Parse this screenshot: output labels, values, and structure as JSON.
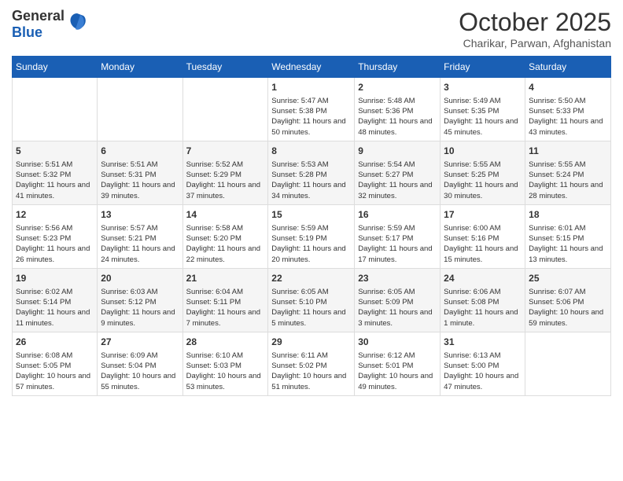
{
  "header": {
    "logo_general": "General",
    "logo_blue": "Blue",
    "month": "October 2025",
    "location": "Charikar, Parwan, Afghanistan"
  },
  "weekdays": [
    "Sunday",
    "Monday",
    "Tuesday",
    "Wednesday",
    "Thursday",
    "Friday",
    "Saturday"
  ],
  "weeks": [
    [
      {
        "day": "",
        "info": ""
      },
      {
        "day": "",
        "info": ""
      },
      {
        "day": "",
        "info": ""
      },
      {
        "day": "1",
        "info": "Sunrise: 5:47 AM\nSunset: 5:38 PM\nDaylight: 11 hours and 50 minutes."
      },
      {
        "day": "2",
        "info": "Sunrise: 5:48 AM\nSunset: 5:36 PM\nDaylight: 11 hours and 48 minutes."
      },
      {
        "day": "3",
        "info": "Sunrise: 5:49 AM\nSunset: 5:35 PM\nDaylight: 11 hours and 45 minutes."
      },
      {
        "day": "4",
        "info": "Sunrise: 5:50 AM\nSunset: 5:33 PM\nDaylight: 11 hours and 43 minutes."
      }
    ],
    [
      {
        "day": "5",
        "info": "Sunrise: 5:51 AM\nSunset: 5:32 PM\nDaylight: 11 hours and 41 minutes."
      },
      {
        "day": "6",
        "info": "Sunrise: 5:51 AM\nSunset: 5:31 PM\nDaylight: 11 hours and 39 minutes."
      },
      {
        "day": "7",
        "info": "Sunrise: 5:52 AM\nSunset: 5:29 PM\nDaylight: 11 hours and 37 minutes."
      },
      {
        "day": "8",
        "info": "Sunrise: 5:53 AM\nSunset: 5:28 PM\nDaylight: 11 hours and 34 minutes."
      },
      {
        "day": "9",
        "info": "Sunrise: 5:54 AM\nSunset: 5:27 PM\nDaylight: 11 hours and 32 minutes."
      },
      {
        "day": "10",
        "info": "Sunrise: 5:55 AM\nSunset: 5:25 PM\nDaylight: 11 hours and 30 minutes."
      },
      {
        "day": "11",
        "info": "Sunrise: 5:55 AM\nSunset: 5:24 PM\nDaylight: 11 hours and 28 minutes."
      }
    ],
    [
      {
        "day": "12",
        "info": "Sunrise: 5:56 AM\nSunset: 5:23 PM\nDaylight: 11 hours and 26 minutes."
      },
      {
        "day": "13",
        "info": "Sunrise: 5:57 AM\nSunset: 5:21 PM\nDaylight: 11 hours and 24 minutes."
      },
      {
        "day": "14",
        "info": "Sunrise: 5:58 AM\nSunset: 5:20 PM\nDaylight: 11 hours and 22 minutes."
      },
      {
        "day": "15",
        "info": "Sunrise: 5:59 AM\nSunset: 5:19 PM\nDaylight: 11 hours and 20 minutes."
      },
      {
        "day": "16",
        "info": "Sunrise: 5:59 AM\nSunset: 5:17 PM\nDaylight: 11 hours and 17 minutes."
      },
      {
        "day": "17",
        "info": "Sunrise: 6:00 AM\nSunset: 5:16 PM\nDaylight: 11 hours and 15 minutes."
      },
      {
        "day": "18",
        "info": "Sunrise: 6:01 AM\nSunset: 5:15 PM\nDaylight: 11 hours and 13 minutes."
      }
    ],
    [
      {
        "day": "19",
        "info": "Sunrise: 6:02 AM\nSunset: 5:14 PM\nDaylight: 11 hours and 11 minutes."
      },
      {
        "day": "20",
        "info": "Sunrise: 6:03 AM\nSunset: 5:12 PM\nDaylight: 11 hours and 9 minutes."
      },
      {
        "day": "21",
        "info": "Sunrise: 6:04 AM\nSunset: 5:11 PM\nDaylight: 11 hours and 7 minutes."
      },
      {
        "day": "22",
        "info": "Sunrise: 6:05 AM\nSunset: 5:10 PM\nDaylight: 11 hours and 5 minutes."
      },
      {
        "day": "23",
        "info": "Sunrise: 6:05 AM\nSunset: 5:09 PM\nDaylight: 11 hours and 3 minutes."
      },
      {
        "day": "24",
        "info": "Sunrise: 6:06 AM\nSunset: 5:08 PM\nDaylight: 11 hours and 1 minute."
      },
      {
        "day": "25",
        "info": "Sunrise: 6:07 AM\nSunset: 5:06 PM\nDaylight: 10 hours and 59 minutes."
      }
    ],
    [
      {
        "day": "26",
        "info": "Sunrise: 6:08 AM\nSunset: 5:05 PM\nDaylight: 10 hours and 57 minutes."
      },
      {
        "day": "27",
        "info": "Sunrise: 6:09 AM\nSunset: 5:04 PM\nDaylight: 10 hours and 55 minutes."
      },
      {
        "day": "28",
        "info": "Sunrise: 6:10 AM\nSunset: 5:03 PM\nDaylight: 10 hours and 53 minutes."
      },
      {
        "day": "29",
        "info": "Sunrise: 6:11 AM\nSunset: 5:02 PM\nDaylight: 10 hours and 51 minutes."
      },
      {
        "day": "30",
        "info": "Sunrise: 6:12 AM\nSunset: 5:01 PM\nDaylight: 10 hours and 49 minutes."
      },
      {
        "day": "31",
        "info": "Sunrise: 6:13 AM\nSunset: 5:00 PM\nDaylight: 10 hours and 47 minutes."
      },
      {
        "day": "",
        "info": ""
      }
    ]
  ]
}
